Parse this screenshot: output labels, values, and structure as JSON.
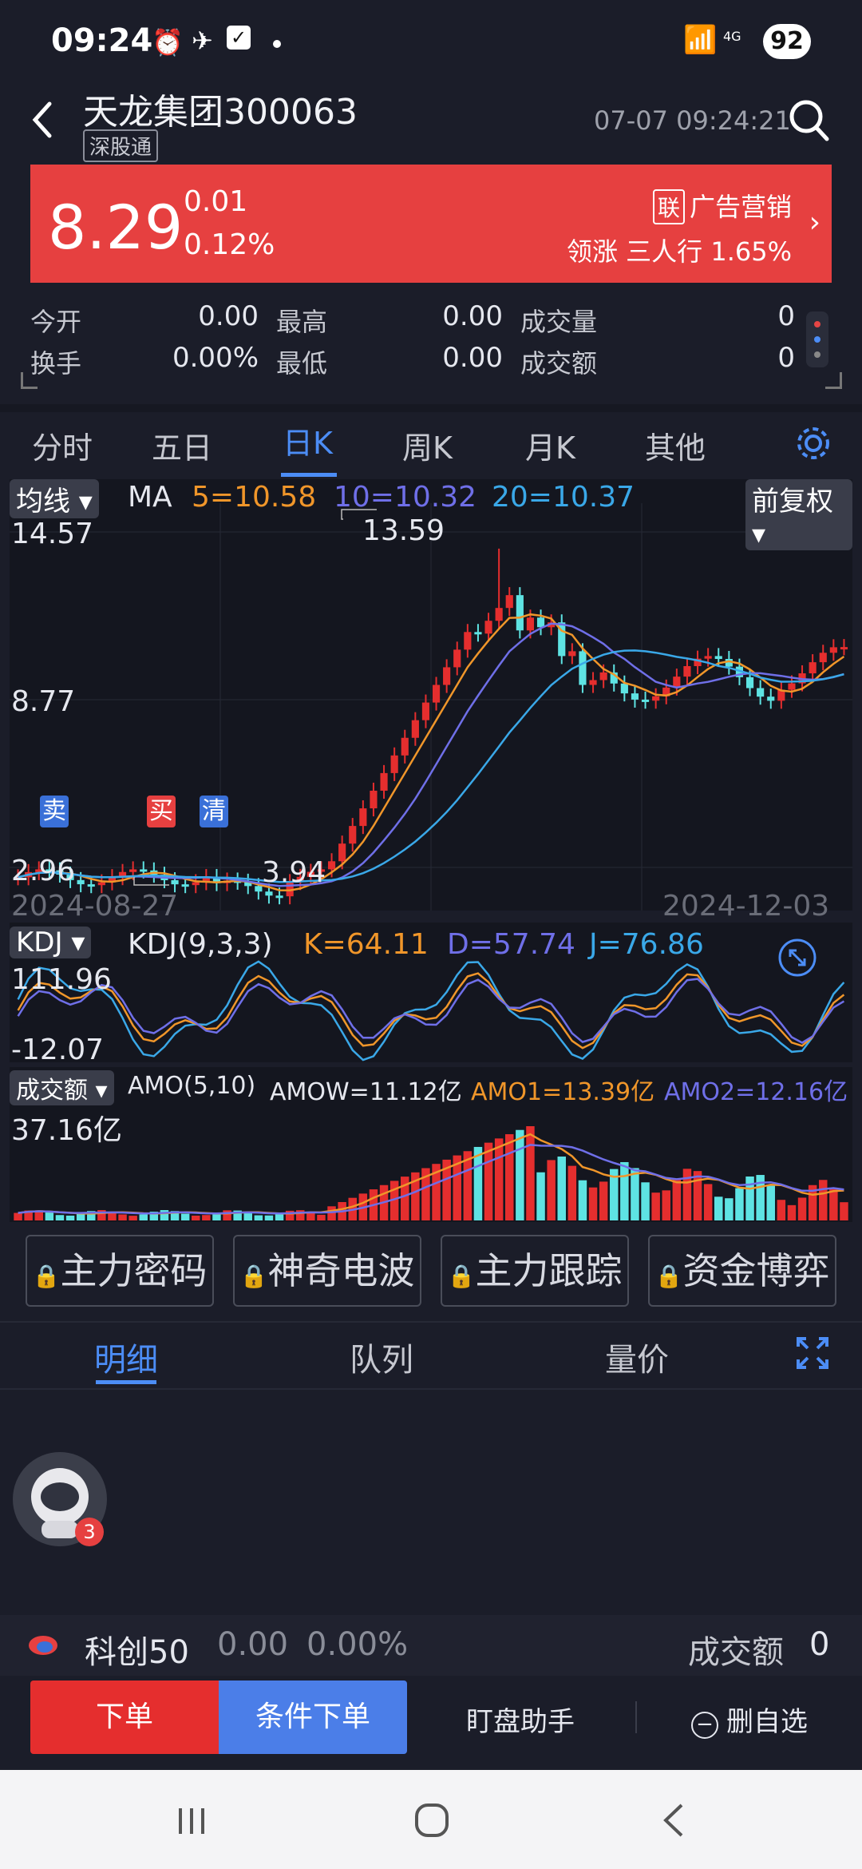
{
  "status": {
    "time": "09:24",
    "battery": "92",
    "net": "4G"
  },
  "header": {
    "title": "天龙集团300063",
    "tag": "深股通",
    "datetime": "07-07 09:24:21"
  },
  "quote": {
    "price": "8.29",
    "change": "0.01",
    "change_pct": "0.12%",
    "ad_badge": "联",
    "ad_text": "广告营销",
    "lead": "领涨 三人行 1.65%"
  },
  "stats": [
    {
      "label": "今开",
      "value": "0.00"
    },
    {
      "label": "最高",
      "value": "0.00"
    },
    {
      "label": "成交量",
      "value": "0"
    },
    {
      "label": "换手",
      "value": "0.00%"
    },
    {
      "label": "最低",
      "value": "0.00"
    },
    {
      "label": "成交额",
      "value": "0"
    }
  ],
  "tabs": [
    "分时",
    "五日",
    "日K",
    "周K",
    "月K",
    "其他"
  ],
  "main_chart": {
    "indicator": "均线",
    "ma_label": "MA",
    "ma5": "5=10.58",
    "ma10": "10=10.32",
    "ma20": "20=10.37",
    "adjust": "前复权",
    "ymax": "14.57",
    "ymid": "8.77",
    "ymin": "2.96",
    "high_mark": "13.59",
    "low_mark": "3.94",
    "date_start": "2024-08-27",
    "date_end": "2024-12-03",
    "sig_sell": "卖",
    "sig_buy": "买",
    "sig_clear": "清"
  },
  "kdj": {
    "name": "KDJ",
    "params": "KDJ(9,3,3)",
    "k": "K=64.11",
    "d": "D=57.74",
    "j": "J=76.86",
    "ymax": "111.96",
    "ymin": "-12.07"
  },
  "amo": {
    "name": "成交额",
    "params": "AMO(5,10)",
    "amow": "AMOW=11.12亿",
    "amo1": "AMO1=13.39亿",
    "amo2": "AMO2=12.16亿",
    "ymax": "37.16亿"
  },
  "features": [
    "主力密码",
    "神奇电波",
    "主力跟踪",
    "资金博弈"
  ],
  "bottom_tabs": [
    "明细",
    "队列",
    "量价"
  ],
  "assistant_badge": "3",
  "index_row": {
    "name": "科创50",
    "value": "0.00",
    "pct": "0.00%",
    "amount_label": "成交额",
    "amount": "0"
  },
  "actions": {
    "order": "下单",
    "cond_order": "条件下单",
    "monitor": "盯盘助手",
    "remove": "删自选"
  },
  "colors": {
    "up": "#e52e2e",
    "down": "#5ee3e3",
    "ma5": "#f0962a",
    "ma10": "#6f6fe8",
    "ma20": "#3aa8e8",
    "accent": "#4c8df6"
  }
}
